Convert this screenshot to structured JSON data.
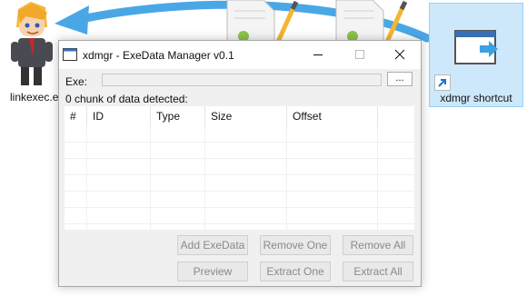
{
  "desktop": {
    "icons": [
      {
        "label": "linkexec.e",
        "icon": "cartoon-character-icon"
      },
      {
        "label": "",
        "icon": "document-pencil-icon"
      },
      {
        "label": "",
        "icon": "document-pencil-icon"
      },
      {
        "label": "xdmgr shortcut",
        "icon": "window-shortcut-icon"
      }
    ],
    "drag_arrow_color": "#4aa7e6"
  },
  "window": {
    "title": "xdmgr - ExeData Manager v0.1",
    "exe_label": "Exe:",
    "exe_value": "",
    "browse_label": "...",
    "status": "0 chunk of data detected:",
    "columns": [
      "#",
      "ID",
      "Type",
      "Size",
      "Offset"
    ],
    "rows": [],
    "buttons": {
      "add": "Add ExeData",
      "remove_one": "Remove One",
      "remove_all": "Remove All",
      "preview": "Preview",
      "extract_one": "Extract One",
      "extract_all": "Extract All"
    }
  }
}
